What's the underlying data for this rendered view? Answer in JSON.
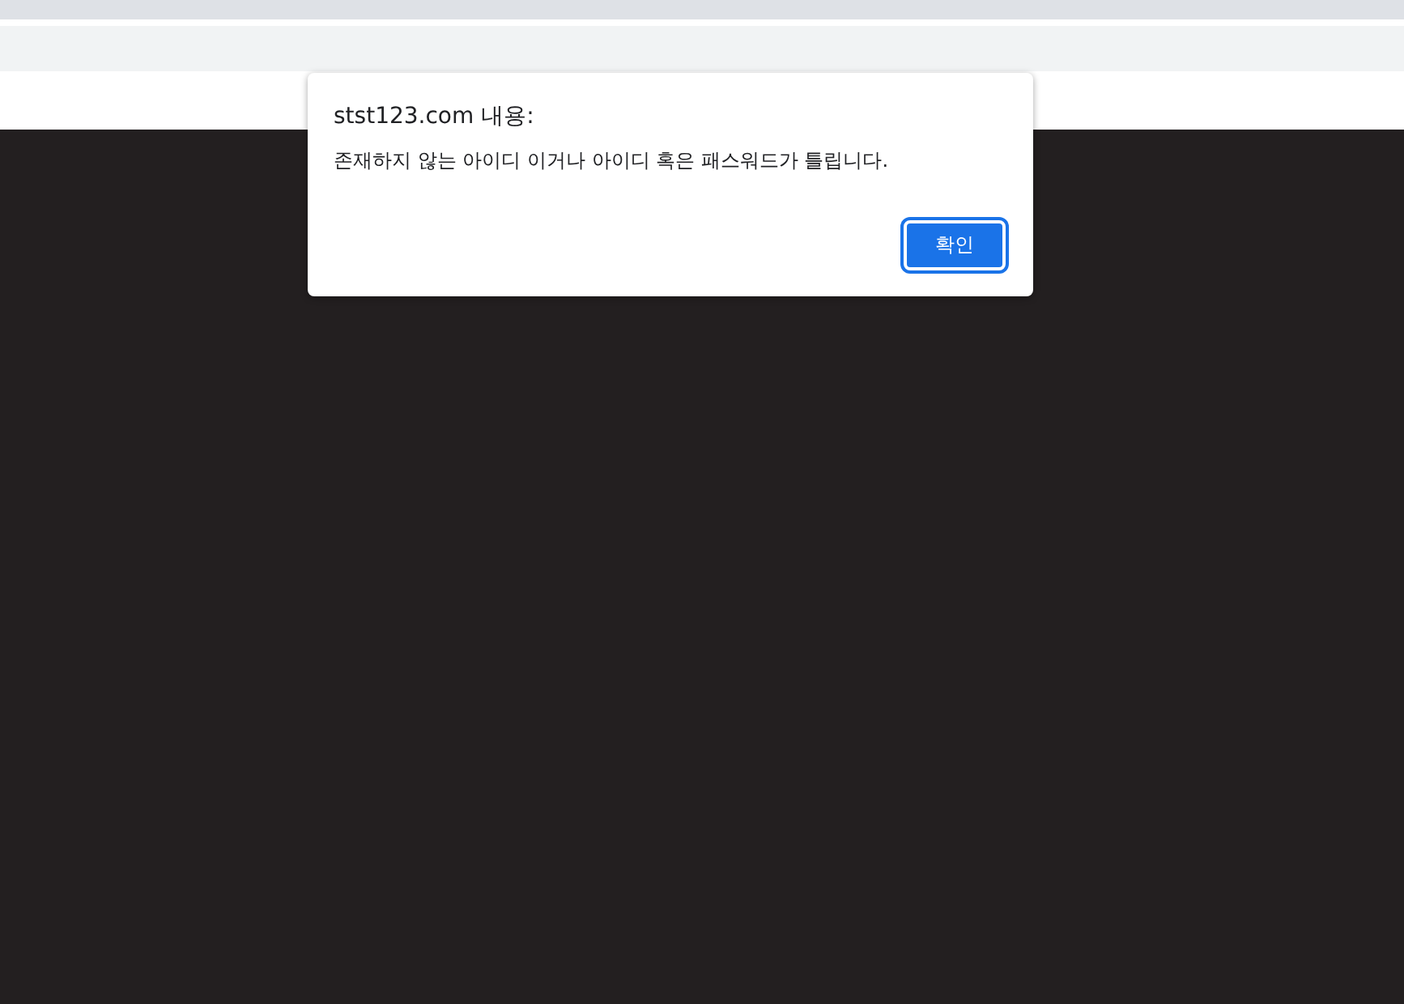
{
  "dialog": {
    "title": "stst123.com 내용:",
    "message": "존재하지 않는 아이디 이거나 아이디 혹은 패스워드가 틀립니다.",
    "buttons": [
      {
        "label": "확인",
        "focused": true
      }
    ]
  }
}
